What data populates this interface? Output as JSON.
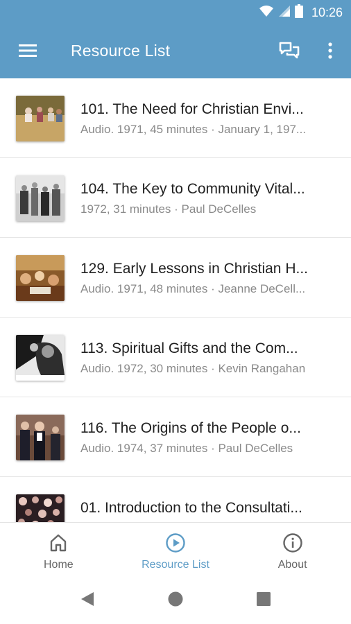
{
  "status_bar": {
    "time": "10:26",
    "icons": [
      "wifi-icon",
      "signal-icon",
      "battery-icon"
    ]
  },
  "app_bar": {
    "title": "Resource List",
    "icons": [
      "menu-icon",
      "chat-icon",
      "more-vert-icon"
    ],
    "color": "#5d9cc6"
  },
  "resources": [
    {
      "title": "101. The Need for Christian Envi...",
      "subtitle": "Audio. 1971, 45 minutes · January 1, 197..."
    },
    {
      "title": "104. The Key to Community Vital...",
      "subtitle": "1972, 31 minutes · Paul DeCelles"
    },
    {
      "title": "129. Early Lessons in Christian H...",
      "subtitle": "Audio. 1971, 48 minutes · Jeanne DeCell..."
    },
    {
      "title": "113. Spiritual Gifts and the Com...",
      "subtitle": "Audio. 1972, 30 minutes · Kevin Rangahan"
    },
    {
      "title": "116. The Origins of the People o...",
      "subtitle": "Audio. 1974, 37 minutes · Paul DeCelles"
    },
    {
      "title": "01. Introduction to the Consultati...",
      "subtitle": ""
    }
  ],
  "bottom_nav": {
    "items": [
      {
        "label": "Home",
        "icon": "home-icon"
      },
      {
        "label": "Resource List",
        "icon": "play-circle-icon",
        "active": true
      },
      {
        "label": "About",
        "icon": "info-icon"
      }
    ],
    "active_color": "#5d9cc6"
  },
  "system_nav": {
    "icons": [
      "back-icon",
      "home-circle-icon",
      "recents-icon"
    ]
  }
}
